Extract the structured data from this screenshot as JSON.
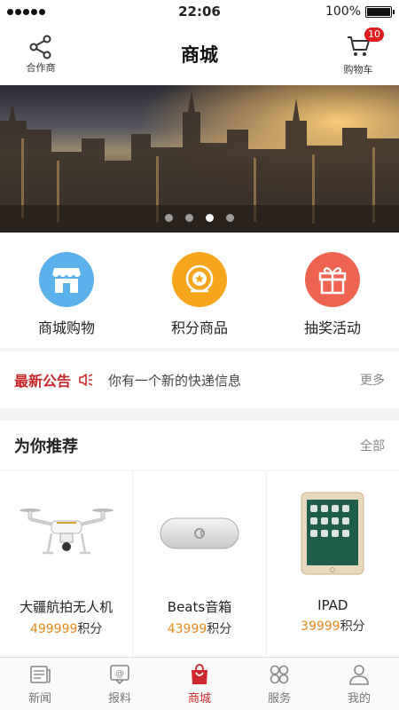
{
  "status_bar": {
    "time": "22:06",
    "battery": "100%",
    "battery_level": 1.0
  },
  "header": {
    "left_label": "合作商",
    "title": "商城",
    "right_label": "购物车",
    "cart_badge": "10"
  },
  "banner": {
    "dots": 4,
    "active_dot": 2
  },
  "categories": [
    {
      "label": "商城购物",
      "icon": "shop-icon",
      "color": "#5ab0ea"
    },
    {
      "label": "积分商品",
      "icon": "medal-icon",
      "color": "#f6a51d"
    },
    {
      "label": "抽奖活动",
      "icon": "gift-icon",
      "color": "#ef6450"
    }
  ],
  "notice": {
    "title": "最新公告",
    "text": "你有一个新的快递信息",
    "more": "更多"
  },
  "recommend": {
    "title": "为你推荐",
    "all": "全部",
    "products": [
      {
        "name": "大疆航拍无人机",
        "points": "499999",
        "unit": "积分",
        "icon": "drone-icon"
      },
      {
        "name": "Beats音箱",
        "points": "43999",
        "unit": "积分",
        "icon": "speaker-icon"
      },
      {
        "name": "IPAD",
        "points": "39999",
        "unit": "积分",
        "icon": "tablet-icon"
      }
    ]
  },
  "tabs": [
    {
      "label": "新闻",
      "icon": "newspaper-icon",
      "active": false
    },
    {
      "label": "报料",
      "icon": "report-icon",
      "active": false
    },
    {
      "label": "商城",
      "icon": "shopping-bag-icon",
      "active": true
    },
    {
      "label": "服务",
      "icon": "services-icon",
      "active": false
    },
    {
      "label": "我的",
      "icon": "user-icon",
      "active": false
    }
  ],
  "colors": {
    "accent": "#d0282d",
    "points": "#e8891e",
    "notice_title": "#c9262a"
  }
}
